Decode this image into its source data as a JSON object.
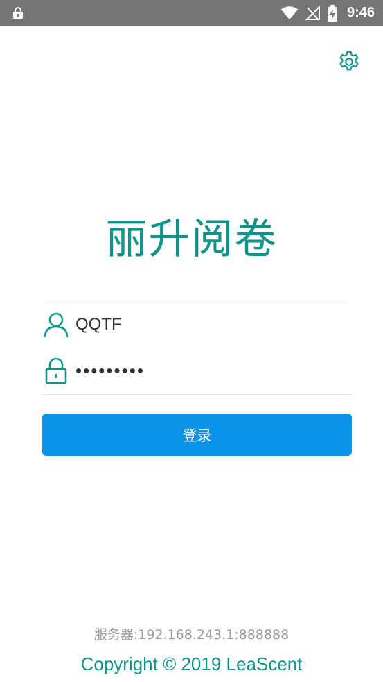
{
  "status_bar": {
    "time": "9:46",
    "icons": [
      "lock-notification-icon",
      "wifi-icon",
      "no-signal-icon",
      "battery-charging-icon"
    ]
  },
  "app": {
    "title": "丽升阅卷"
  },
  "form": {
    "username_value": "QQTF",
    "password_value": "•••••••••",
    "login_label": "登录"
  },
  "footer": {
    "server": "服务器:192.168.243.1:888888",
    "copyright": "Copyright © 2019 LeaScent"
  },
  "colors": {
    "accent_teal": "#0e9488",
    "button_blue": "#0a93e8",
    "status_bar_gray": "#757575"
  }
}
